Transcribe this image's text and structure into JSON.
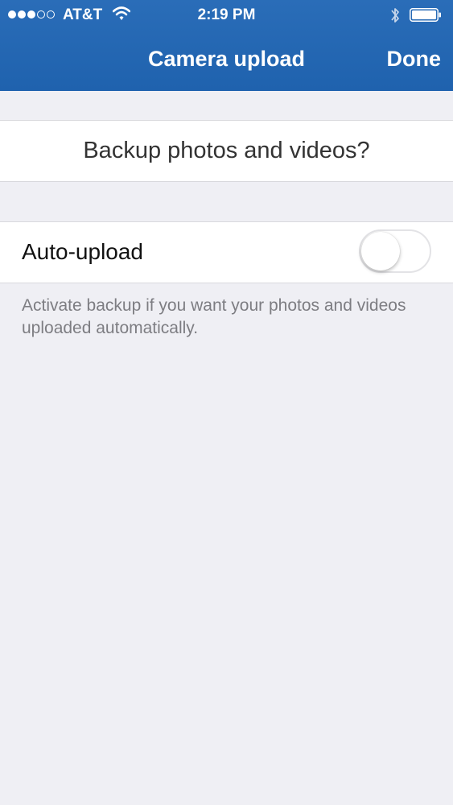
{
  "status_bar": {
    "carrier": "AT&T",
    "time": "2:19 PM",
    "signal_bars_filled": 3,
    "signal_bars_total": 5,
    "icons": [
      "wifi-icon",
      "bluetooth-icon",
      "battery-icon"
    ]
  },
  "nav": {
    "title": "Camera upload",
    "done_label": "Done"
  },
  "question": {
    "text": "Backup photos and videos?"
  },
  "auto_upload": {
    "label": "Auto-upload",
    "enabled": false,
    "footnote": "Activate backup if you want your photos and videos uploaded automatically."
  },
  "colors": {
    "nav_bar": "#1f62ae",
    "background": "#efeff4",
    "footnote_text": "#7d7d82"
  }
}
